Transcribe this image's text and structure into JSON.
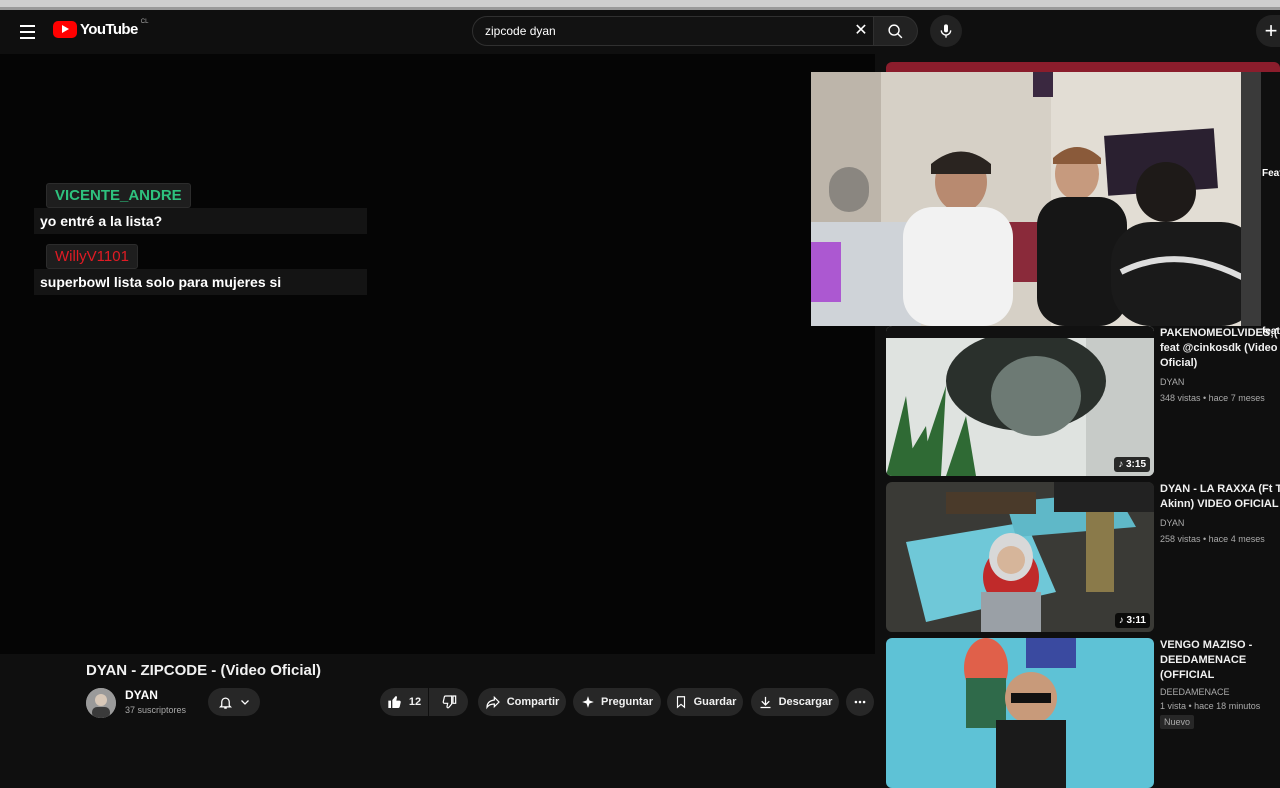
{
  "header": {
    "logo_text": "YouTube",
    "country_code": "CL",
    "search_value": "zipcode dyan"
  },
  "chat": [
    {
      "user": "VICENTE_ANDRE",
      "user_color": "#2ec27e",
      "message": "yo entré a la lista?"
    },
    {
      "user": "WillyV1101",
      "user_color": "#e01b24",
      "message": "superbowl lista solo para mujeres si"
    }
  ],
  "side_stubs": {
    "feat_top": "Feat",
    "feat_mid": "feat"
  },
  "recommendations": [
    {
      "title": "PAKENOMEOLVIDES;( feat @cinkosdk (Video Oficial)",
      "channel": "DYAN",
      "meta": "348 vistas • hace 7 meses",
      "duration": "3:15",
      "badge": ""
    },
    {
      "title": "DYAN - LA RAXXA (Ft Tim Akinn) VIDEO OFICIAL",
      "channel": "DYAN",
      "meta": "258 vistas • hace 4 meses",
      "duration": "3:11",
      "badge": ""
    },
    {
      "title": "VENGO MAZISO - DEEDAMENACE (OFFICIAL",
      "channel": "DEEDAMENACE",
      "meta": "1 vista • hace 18 minutos",
      "duration": "",
      "badge": "Nuevo"
    }
  ],
  "video": {
    "title": "DYAN - ZIPCODE - (Video Oficial)",
    "channel": "DYAN",
    "subscribers": "37 suscriptores",
    "likes": "12",
    "share": "Compartir",
    "ask": "Preguntar",
    "save": "Guardar",
    "download": "Descargar"
  }
}
